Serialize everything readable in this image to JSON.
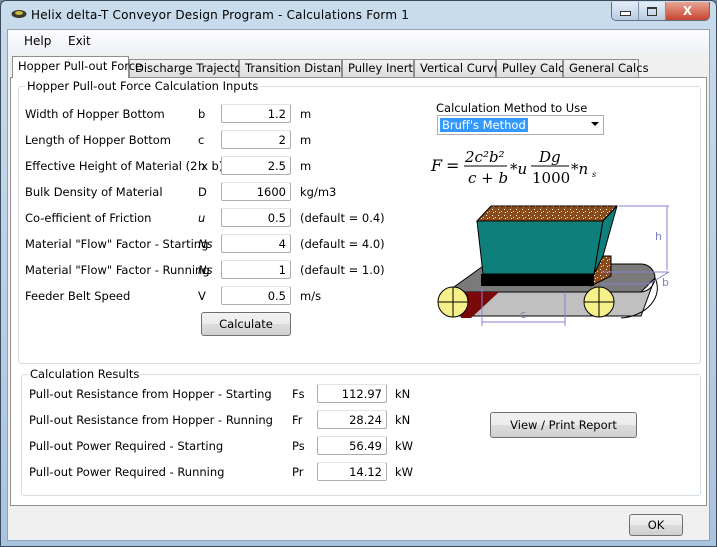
{
  "window": {
    "title": "Helix delta-T Conveyor Design Program - Calculations Form 1",
    "controls": {
      "minimize": "—",
      "maximize": "□",
      "close": "X"
    }
  },
  "menu": {
    "items": [
      "Help",
      "Exit"
    ]
  },
  "tabs": [
    {
      "label": "Hopper Pull-out Force",
      "active": true
    },
    {
      "label": "Discharge Trajectory",
      "active": false
    },
    {
      "label": "Transition Distance",
      "active": false
    },
    {
      "label": "Pulley Inertia",
      "active": false
    },
    {
      "label": "Vertical Curves",
      "active": false
    },
    {
      "label": "Pulley Calcs",
      "active": false
    },
    {
      "label": "General Calcs",
      "active": false
    }
  ],
  "inputs": {
    "group_title": "Hopper Pull-out Force Calculation Inputs",
    "rows": [
      {
        "label": "Width of Hopper Bottom",
        "symbol": "b",
        "value": "1.2",
        "unit": "m"
      },
      {
        "label": "Length of Hopper Bottom",
        "symbol": "c",
        "value": "2",
        "unit": "m"
      },
      {
        "label": "Effective Height of Material (2 x b)",
        "symbol": "h",
        "value": "2.5",
        "unit": "m"
      },
      {
        "label": "Bulk Density of Material",
        "symbol": "D",
        "value": "1600",
        "unit": "kg/m3"
      },
      {
        "label": "Co-efficient of Friction",
        "symbol": "u",
        "value": "0.5",
        "unit": "(default = 0.4)"
      },
      {
        "label": "Material \"Flow\" Factor - Starting",
        "symbol": "Ns",
        "value": "4",
        "unit": "(default = 4.0)"
      },
      {
        "label": "Material \"Flow\" Factor - Running",
        "symbol": "Ns",
        "value": "1",
        "unit": "(default = 1.0)"
      },
      {
        "label": "Feeder Belt Speed",
        "symbol": "V",
        "value": "0.5",
        "unit": "m/s"
      }
    ],
    "calculate_label": "Calculate",
    "method_label": "Calculation Method to Use",
    "method_value": "Bruff's Method",
    "formula": {
      "lhs": "F",
      "num1": "2c²b²",
      "den1": "c + b",
      "mid": "*u",
      "num2": "Dg",
      "den2": "1000",
      "tail": "*n",
      "tail_sub": "s"
    },
    "diagram": {
      "label_h": "h",
      "label_b": "b",
      "label_c": "c"
    }
  },
  "results": {
    "group_title": "Calculation Results",
    "rows": [
      {
        "label": "Pull-out Resistance from Hopper - Starting",
        "symbol": "Fs",
        "value": "112.97",
        "unit": "kN"
      },
      {
        "label": "Pull-out Resistance from Hopper - Running",
        "symbol": "Fr",
        "value": "28.24",
        "unit": "kN"
      },
      {
        "label": "Pull-out Power Required - Starting",
        "symbol": "Ps",
        "value": "56.49",
        "unit": "kW"
      },
      {
        "label": "Pull-out Power Required - Running",
        "symbol": "Pr",
        "value": "14.12",
        "unit": "kW"
      }
    ],
    "report_label": "View / Print Report"
  },
  "footer": {
    "ok_label": "OK"
  }
}
